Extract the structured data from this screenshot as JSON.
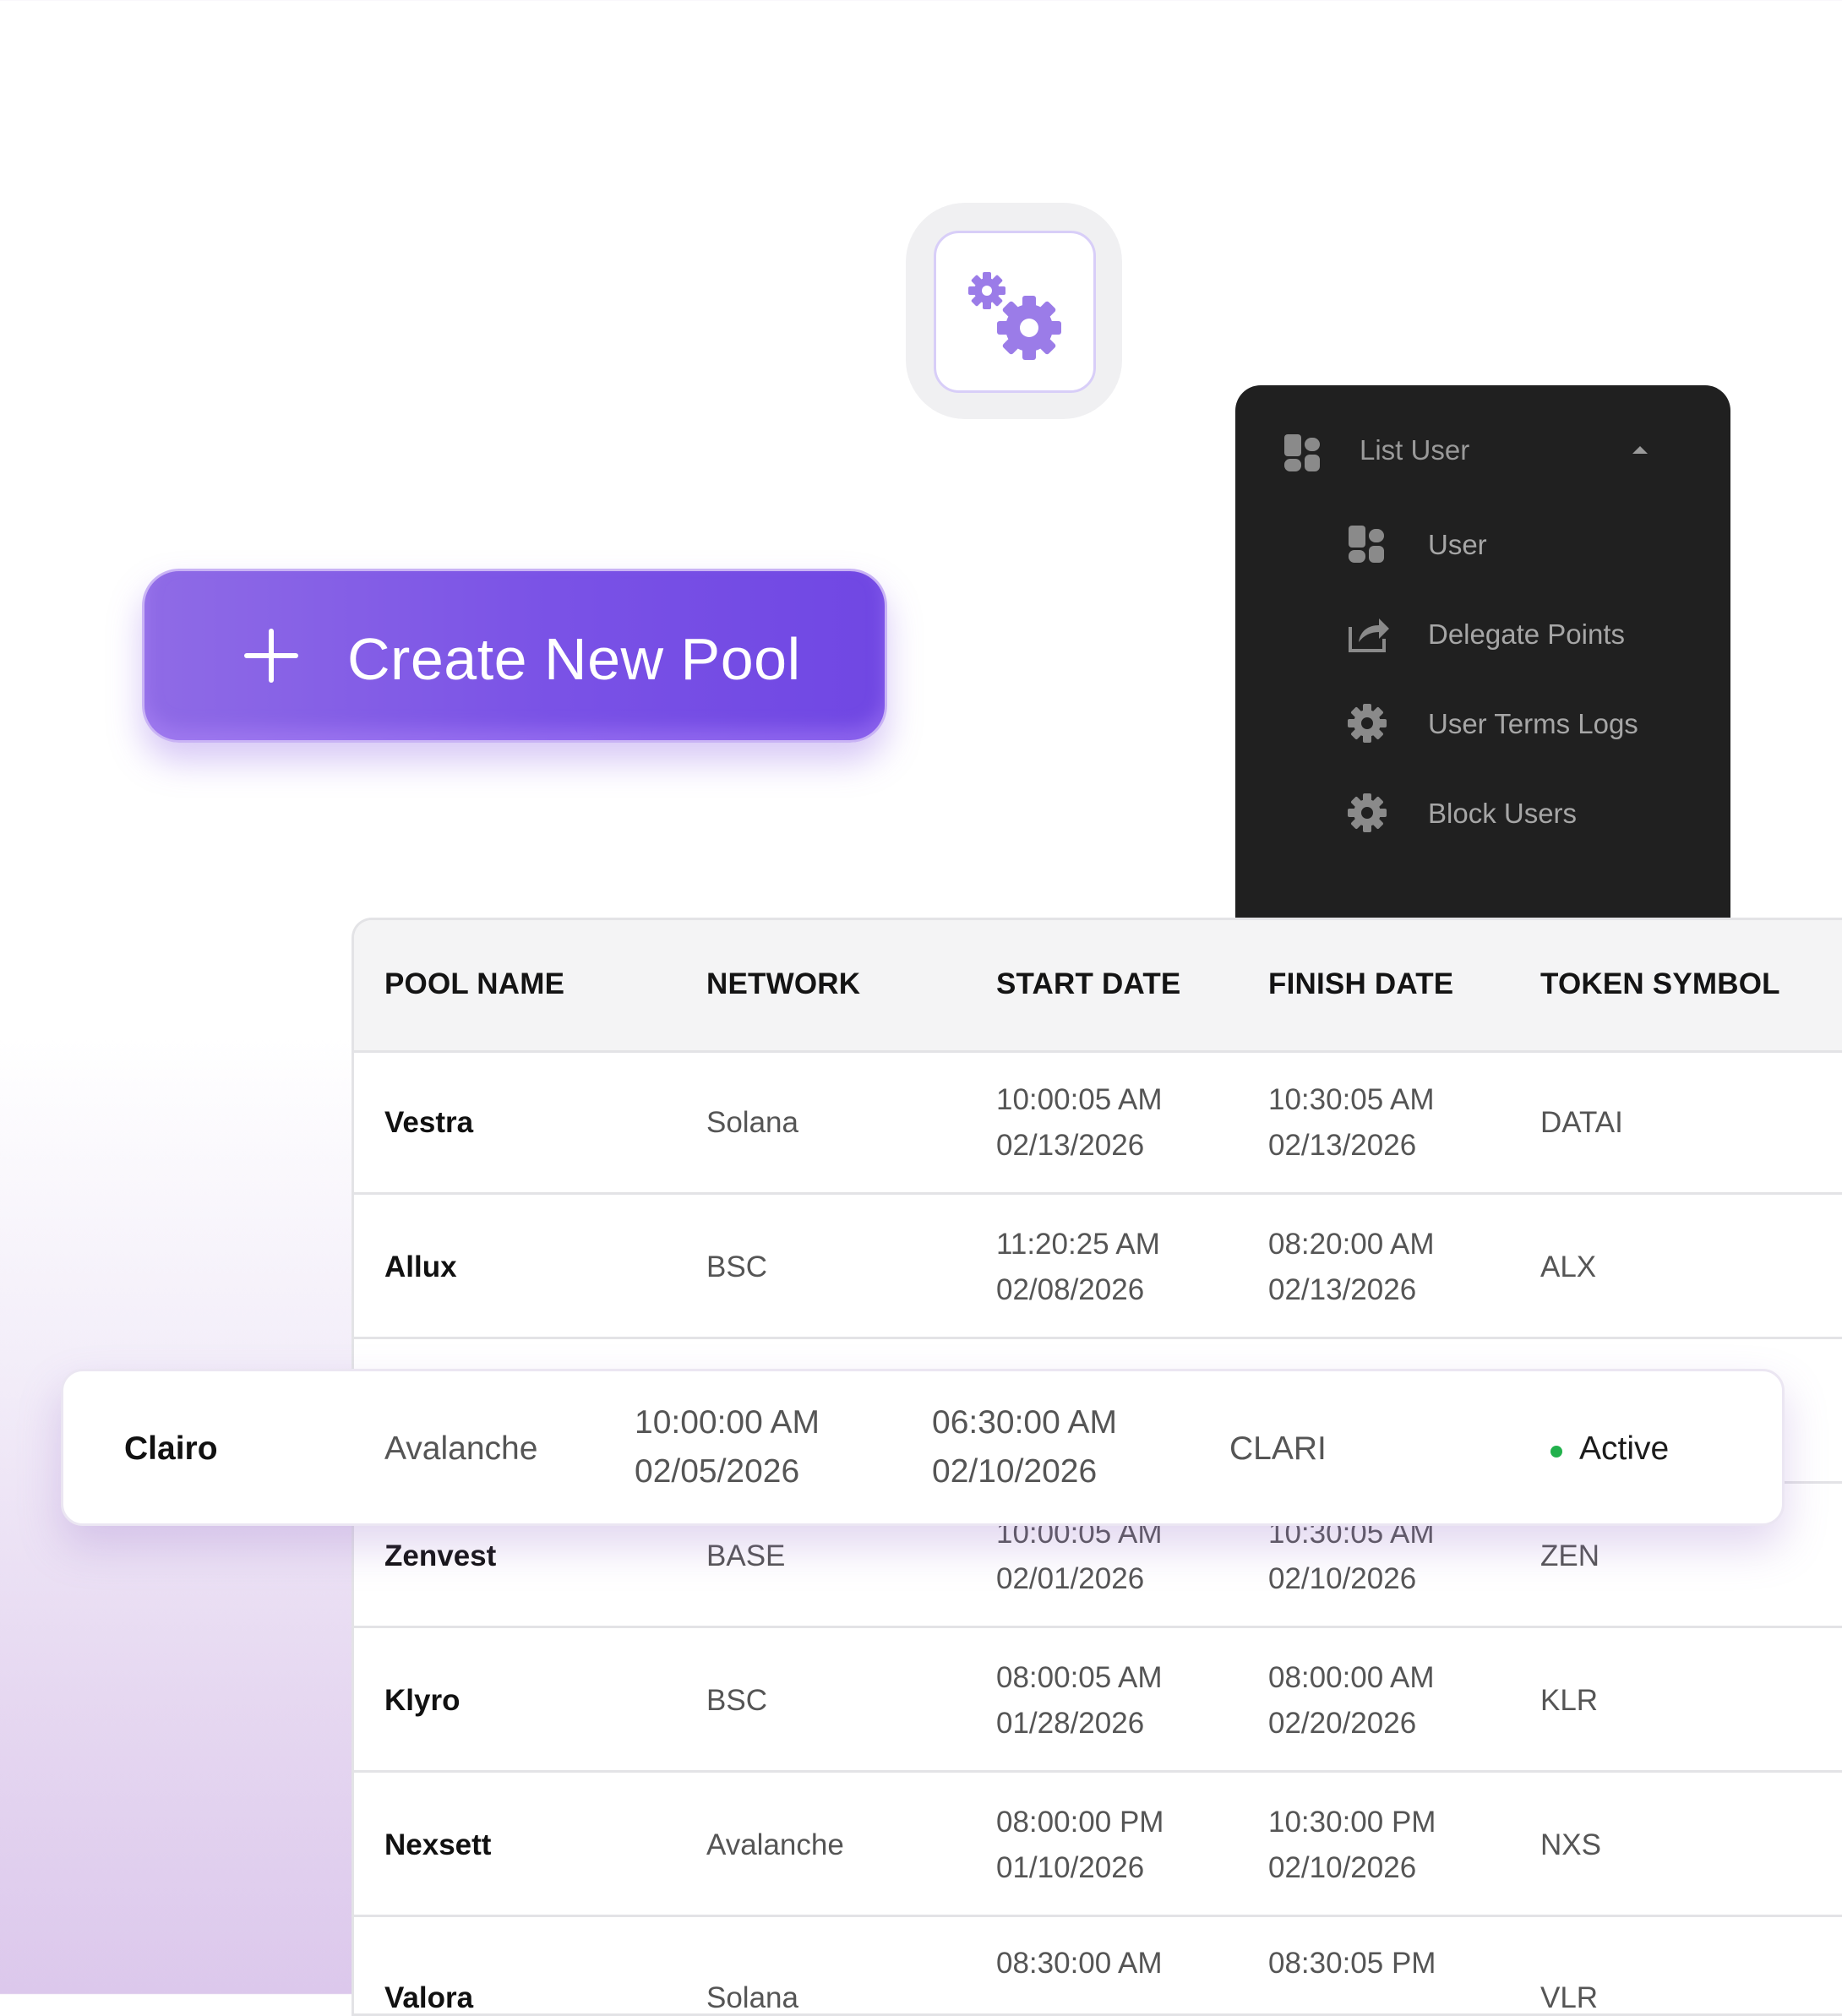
{
  "settings_tile": {
    "icon": "gears-icon",
    "color": "#9b7ce8"
  },
  "create_button": {
    "icon": "plus-icon",
    "label": "Create New Pool"
  },
  "menu": {
    "header": {
      "icon": "grid-icon",
      "label": "List User",
      "caret": "caret-up-icon"
    },
    "items": [
      {
        "icon": "grid-icon",
        "label": "User"
      },
      {
        "icon": "share-icon",
        "label": "Delegate Points"
      },
      {
        "icon": "gear-icon",
        "label": "User Terms Logs"
      },
      {
        "icon": "gear-icon",
        "label": "Block Users"
      }
    ]
  },
  "table": {
    "columns": [
      "POOL NAME",
      "NETWORK",
      "START DATE",
      "FINISH DATE",
      "TOKEN SYMBOL"
    ],
    "rows": [
      {
        "name": "Vestra",
        "network": "Solana",
        "start_time": "10:00:05 AM",
        "start_date": "02/13/2026",
        "finish_time": "10:30:05 AM",
        "finish_date": "02/13/2026",
        "token": "DATAI"
      },
      {
        "name": "Allux",
        "network": "BSC",
        "start_time": "11:20:25 AM",
        "start_date": "02/08/2026",
        "finish_time": "08:20:00 AM",
        "finish_date": "02/13/2026",
        "token": "ALX"
      },
      {
        "name": "",
        "network": "",
        "start_time": "",
        "start_date": "",
        "finish_time": "",
        "finish_date": "",
        "token": ""
      },
      {
        "name": "Zenvest",
        "network": "BASE",
        "start_time": "10:00:05 AM",
        "start_date": "02/01/2026",
        "finish_time": "10:30:05 AM",
        "finish_date": "02/10/2026",
        "token": "ZEN"
      },
      {
        "name": "Klyro",
        "network": "BSC",
        "start_time": "08:00:05 AM",
        "start_date": "01/28/2026",
        "finish_time": "08:00:00 AM",
        "finish_date": "02/20/2026",
        "token": "KLR"
      },
      {
        "name": "Nexsett",
        "network": "Avalanche",
        "start_time": "08:00:00 PM",
        "start_date": "01/10/2026",
        "finish_time": "10:30:00 PM",
        "finish_date": "02/10/2026",
        "token": "NXS"
      },
      {
        "name": "Valora",
        "network": "Solana",
        "start_time": "08:30:00 AM",
        "start_date": "",
        "finish_time": "08:30:05 PM",
        "finish_date": "",
        "token": "VLR"
      }
    ]
  },
  "highlight_row": {
    "name": "Clairo",
    "network": "Avalanche",
    "start_time": "10:00:00 AM",
    "start_date": "02/05/2026",
    "finish_time": "06:30:00 AM",
    "finish_date": "02/10/2026",
    "token": "CLARI",
    "status": "Active",
    "status_color": "#22b14c"
  }
}
